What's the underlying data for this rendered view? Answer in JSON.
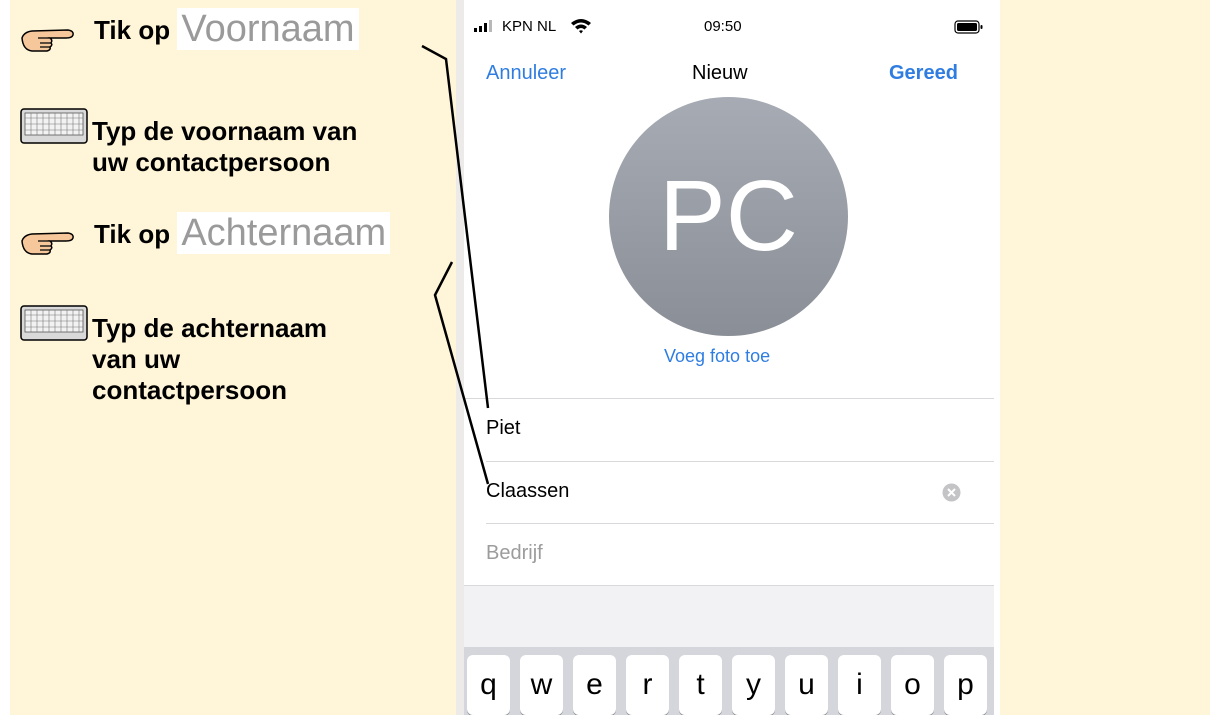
{
  "instructions": [
    {
      "icon": "pointing-hand-icon",
      "prefix": "Tik op",
      "key": "Voornaam"
    },
    {
      "icon": "keyboard-icon",
      "line1": "Typ de voornaam van",
      "line2": "uw contactpersoon"
    },
    {
      "icon": "pointing-hand-icon",
      "prefix": "Tik op",
      "key": "Achternaam"
    },
    {
      "icon": "keyboard-icon",
      "line1": "Typ de achternaam",
      "line2": "van uw",
      "line3": "contactpersoon"
    }
  ],
  "status_bar": {
    "carrier": "KPN NL",
    "time": "09:50"
  },
  "nav": {
    "cancel": "Annuleer",
    "title": "Nieuw",
    "done": "Gereed"
  },
  "avatar": {
    "initials": "PC",
    "add_photo": "Voeg foto toe"
  },
  "fields": {
    "first_name": "Piet",
    "last_name": "Claassen",
    "company_placeholder": "Bedrijf"
  },
  "keyboard": {
    "row1": [
      "q",
      "w",
      "e",
      "r",
      "t",
      "y",
      "u",
      "i",
      "o",
      "p"
    ]
  },
  "colors": {
    "accent": "#2f7de1",
    "panel_background": "#fff5d8",
    "avatar": "#9a9ea6"
  }
}
